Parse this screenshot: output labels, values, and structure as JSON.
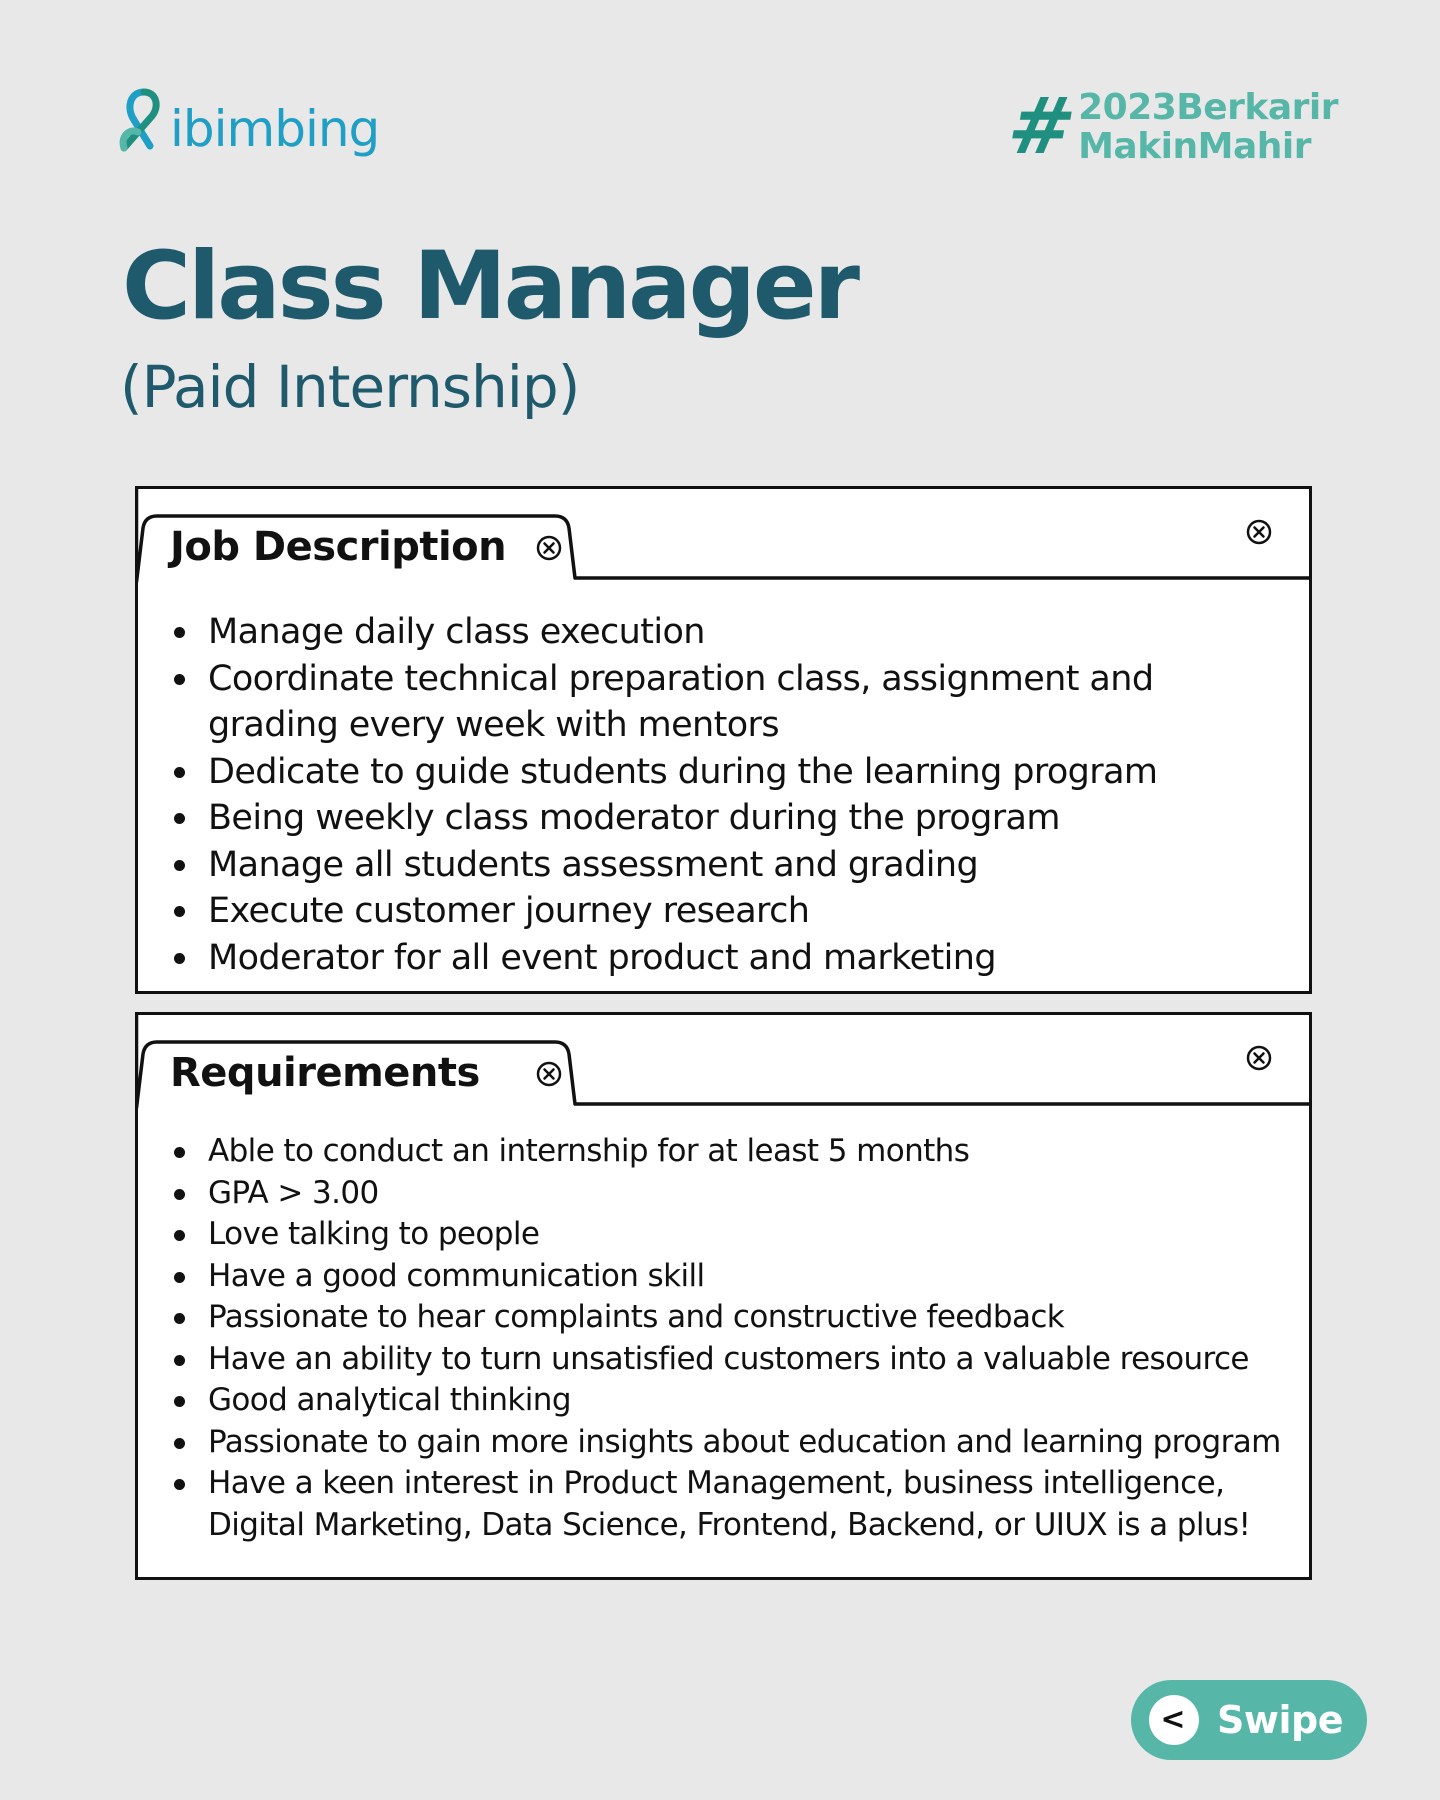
{
  "brand": {
    "logo_text": "ibimbing",
    "hashtag_line1": "2023Berkarir",
    "hashtag_line2": "MakinMahir",
    "hash_symbol": "#",
    "colors": {
      "background": "#e8e8e8",
      "primary": "#1e5a6c",
      "teal": "#56b6a8",
      "logo_blue": "#1f9fc6"
    }
  },
  "header": {
    "title": "Class Manager",
    "subtitle": "(Paid Internship)"
  },
  "job_description": {
    "tab_label": "Job Description",
    "tab_close_icon": "close-circle-icon",
    "panel_close_icon": "close-circle-icon",
    "items": [
      "Manage daily class execution",
      "Coordinate technical preparation class, assignment and grading every week with mentors",
      "Dedicate to guide students during the learning program",
      "Being weekly class moderator during the program",
      "Manage all students assessment and grading",
      "Execute customer journey research",
      "Moderator for all event product and marketing"
    ]
  },
  "requirements": {
    "tab_label": "Requirements",
    "tab_close_icon": "close-circle-icon",
    "panel_close_icon": "close-circle-icon",
    "items": [
      "Able to conduct an internship for at least 5 months",
      "GPA > 3.00",
      "Love talking to people",
      "Have a good communication skill",
      "Passionate to hear complaints and constructive feedback",
      "Have an ability to turn unsatisfied customers into a valuable resource",
      "Good analytical thinking",
      "Passionate to gain more insights about education and learning program",
      "Have a keen interest in Product Management, business intelligence, Digital Marketing, Data Science, Frontend, Backend, or UIUX is a plus!"
    ]
  },
  "swipe_button": {
    "label": "Swipe",
    "arrow": "<",
    "icon": "chevron-left-icon"
  }
}
